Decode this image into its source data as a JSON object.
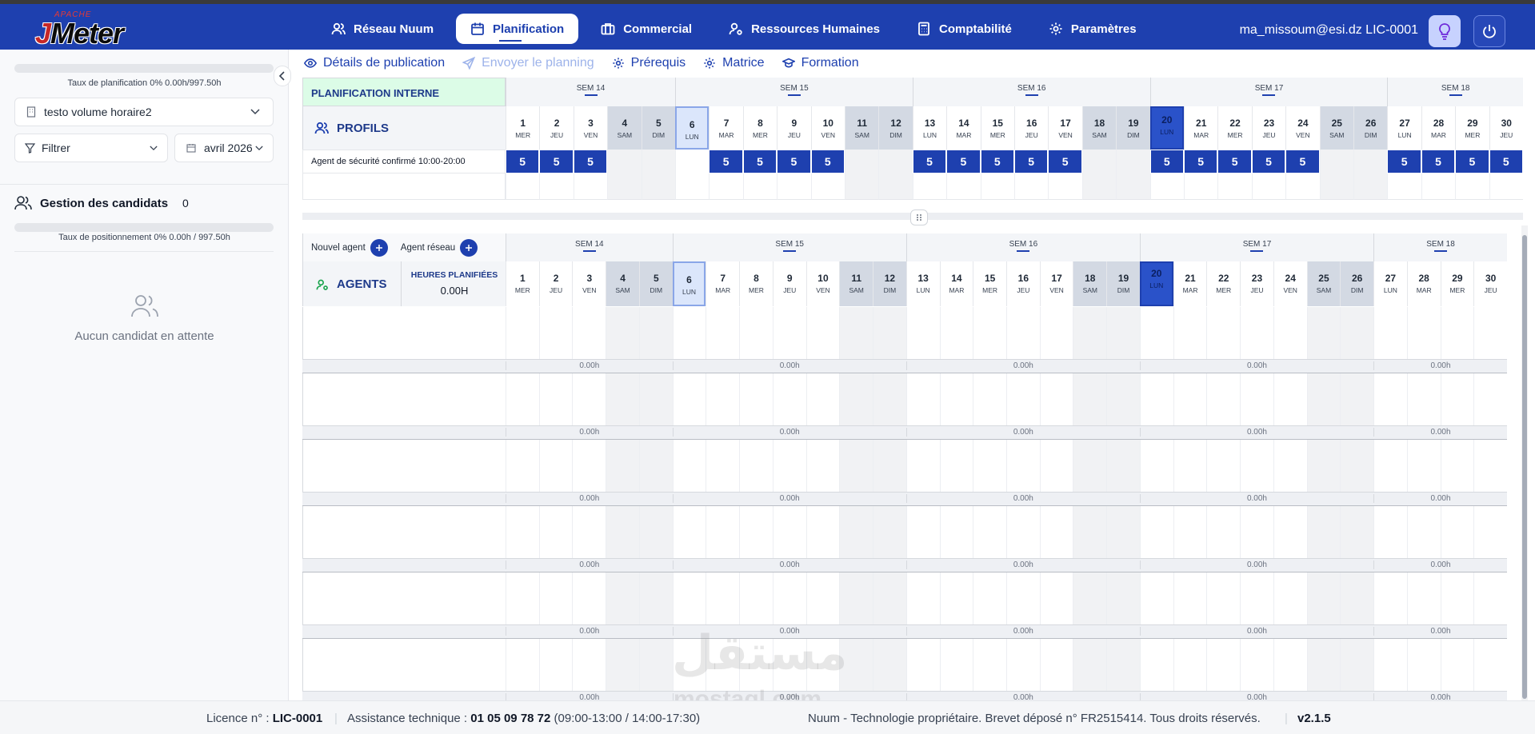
{
  "topbar": {
    "logo_small": "APACHE",
    "logo_main_j": "J",
    "logo_main_rest": "Meter",
    "nav": [
      {
        "label": "Réseau Nuum",
        "icon": "users-icon",
        "active": false
      },
      {
        "label": "Planification",
        "icon": "calendar-icon",
        "active": true
      },
      {
        "label": "Commercial",
        "icon": "briefcase-icon",
        "active": false
      },
      {
        "label": "Ressources Humaines",
        "icon": "user-settings-icon",
        "active": false
      },
      {
        "label": "Comptabilité",
        "icon": "calculator-icon",
        "active": false
      },
      {
        "label": "Paramètres",
        "icon": "gear-icon",
        "active": false
      }
    ],
    "user": "ma_missoum@esi.dz LIC-0001"
  },
  "sidebar": {
    "planif_rate": "Taux de planification 0% 0.00h/997.50h",
    "planif_progress": 0,
    "site_select": "testo volume horaire2",
    "filter_label": "Filtrer",
    "month_select": "avril 2026",
    "candidates_title": "Gestion des candidats",
    "candidates_count": "0",
    "position_rate": "Taux de positionnement 0% 0.00h / 997.50h",
    "position_progress": 0,
    "empty_text": "Aucun candidat en attente"
  },
  "toolbar": {
    "items": [
      {
        "label": "Détails de publication",
        "icon": "eye-icon",
        "disabled": false
      },
      {
        "label": "Envoyer le planning",
        "icon": "send-icon",
        "disabled": true
      },
      {
        "label": "Prérequis",
        "icon": "gear-icon",
        "disabled": false
      },
      {
        "label": "Matrice",
        "icon": "gear-icon",
        "disabled": false
      },
      {
        "label": "Formation",
        "icon": "graduation-cap-icon",
        "disabled": false
      }
    ]
  },
  "profils_grid": {
    "header_label": "PLANIFICATION INTERNE",
    "section_label": "PROFILS",
    "row_label": "Agent de sécurité confirmé 10:00-20:00"
  },
  "agents_grid": {
    "new_agent": "Nouvel agent",
    "network_agent": "Agent réseau",
    "section_label": "AGENTS",
    "hours_label": "HEURES PLANIFIÉES",
    "hours_value": "0.00H",
    "summary_value": "0.00h"
  },
  "weeks": [
    "SEM 14",
    "SEM 15",
    "SEM 16",
    "SEM 17",
    "SEM 18"
  ],
  "days": [
    {
      "n": "1",
      "w": "MER"
    },
    {
      "n": "2",
      "w": "JEU"
    },
    {
      "n": "3",
      "w": "VEN"
    },
    {
      "n": "4",
      "w": "SAM"
    },
    {
      "n": "5",
      "w": "DIM"
    },
    {
      "n": "6",
      "w": "LUN"
    },
    {
      "n": "7",
      "w": "MAR"
    },
    {
      "n": "8",
      "w": "MER"
    },
    {
      "n": "9",
      "w": "JEU"
    },
    {
      "n": "10",
      "w": "VEN"
    },
    {
      "n": "11",
      "w": "SAM"
    },
    {
      "n": "12",
      "w": "DIM"
    },
    {
      "n": "13",
      "w": "LUN"
    },
    {
      "n": "14",
      "w": "MAR"
    },
    {
      "n": "15",
      "w": "MER"
    },
    {
      "n": "16",
      "w": "JEU"
    },
    {
      "n": "17",
      "w": "VEN"
    },
    {
      "n": "18",
      "w": "SAM"
    },
    {
      "n": "19",
      "w": "DIM"
    },
    {
      "n": "20",
      "w": "LUN"
    },
    {
      "n": "21",
      "w": "MAR"
    },
    {
      "n": "22",
      "w": "MER"
    },
    {
      "n": "23",
      "w": "JEU"
    },
    {
      "n": "24",
      "w": "VEN"
    },
    {
      "n": "25",
      "w": "SAM"
    },
    {
      "n": "26",
      "w": "DIM"
    },
    {
      "n": "27",
      "w": "LUN"
    },
    {
      "n": "28",
      "w": "MAR"
    },
    {
      "n": "29",
      "w": "MER"
    },
    {
      "n": "30",
      "w": "JEU"
    }
  ],
  "profile_values": [
    "5",
    "5",
    "5",
    "",
    "",
    "",
    "5",
    "5",
    "5",
    "5",
    "",
    "",
    "5",
    "5",
    "5",
    "5",
    "5",
    "",
    "",
    "5",
    "5",
    "5",
    "5",
    "5",
    "",
    "",
    "5",
    "5",
    "5",
    "5"
  ],
  "footer": {
    "licence_label": "Licence n° : ",
    "licence_value": "LIC-0001",
    "support_label": "Assistance technique : ",
    "support_phone": "01 05 09 78 72",
    "support_hours": " (09:00-13:00 / 14:00-17:30)",
    "copyright": "Nuum - Technologie propriétaire. Brevet déposé n° FR2515414. Tous droits réservés.",
    "version": "v2.1.5"
  },
  "watermark": {
    "arabic": "مستقل",
    "latin": "mostaql.com"
  },
  "colors": {
    "primary": "#1e40af",
    "today": "#2a52c9",
    "weekend": "#d3d9e3",
    "selected": "#dbe6fb",
    "accent_green": "#16a34a"
  }
}
